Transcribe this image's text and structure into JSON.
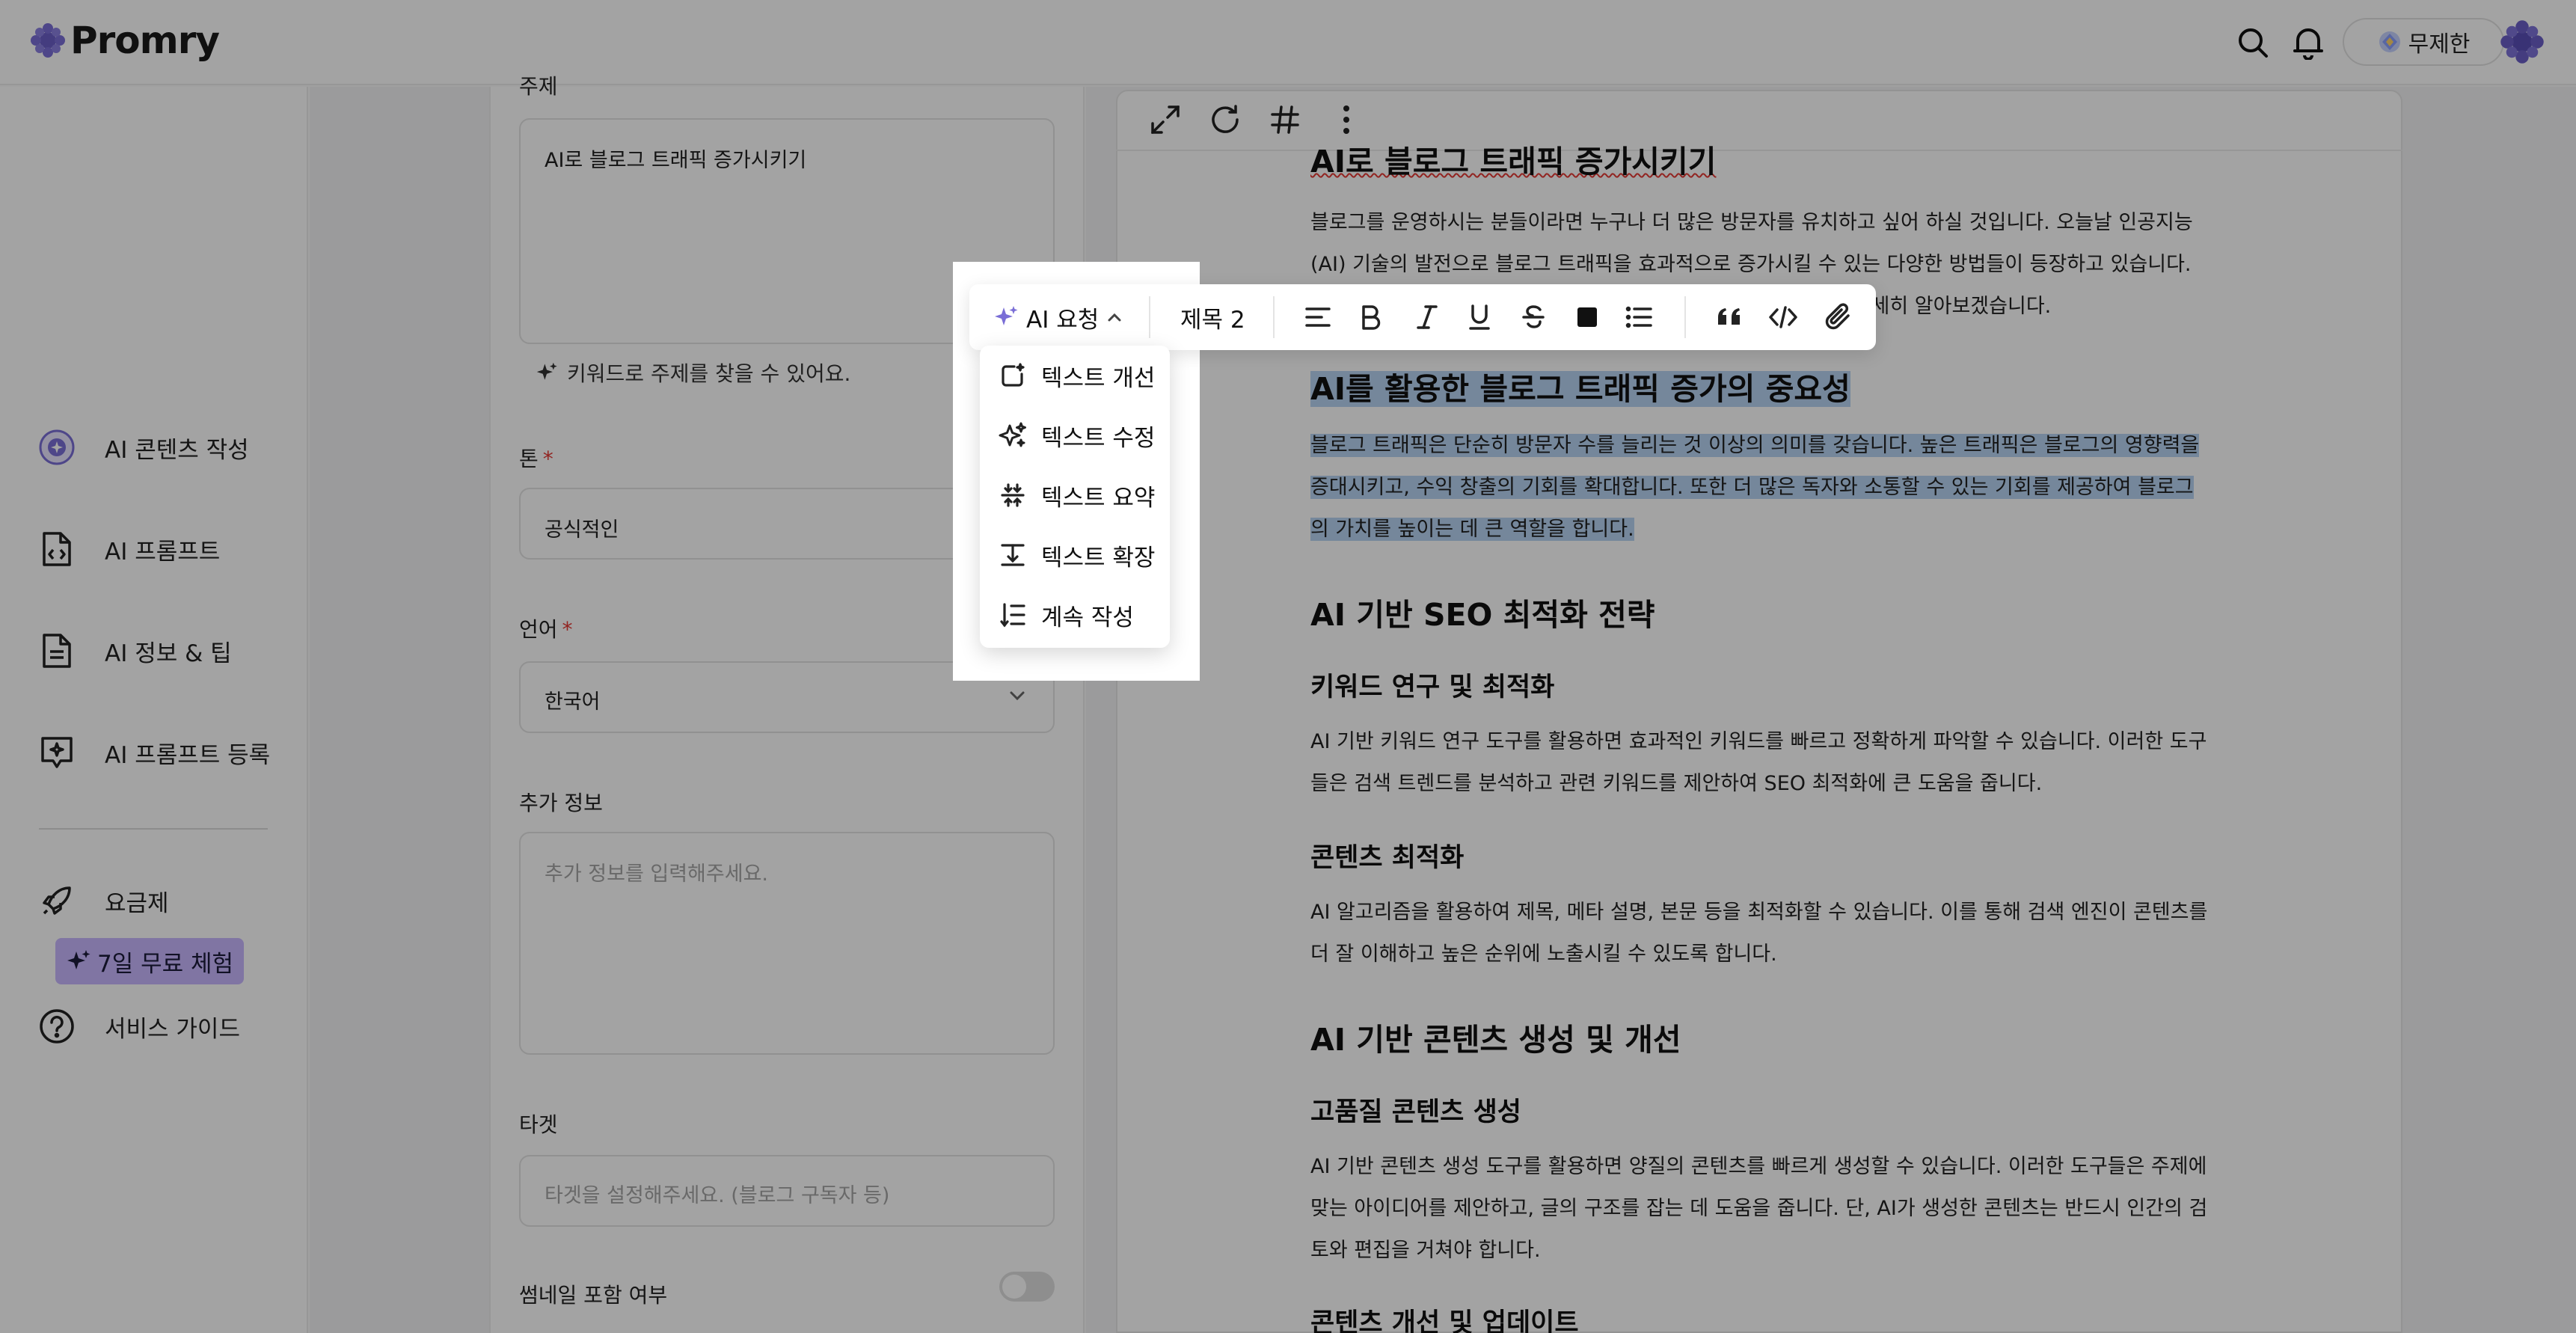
{
  "app": {
    "brand": "Promry",
    "plan_label": "무제한"
  },
  "sidebar": {
    "items": [
      {
        "label": "AI 콘텐츠 작성",
        "icon": "ai-content-icon"
      },
      {
        "label": "AI 프롬프트",
        "icon": "code-file-icon"
      },
      {
        "label": "AI 정보 & 팁",
        "icon": "document-icon"
      },
      {
        "label": "AI 프롬프트 등록",
        "icon": "chat-add-icon"
      },
      {
        "label": "요금제",
        "icon": "rocket-icon"
      },
      {
        "label": "서비스 가이드",
        "icon": "help-circle-icon"
      }
    ],
    "trial_badge": "7일 무료 체험"
  },
  "form": {
    "topic_label": "주제",
    "topic_value": "AI로 블로그 트래픽 증가시키기",
    "topic_hint": "키워드로 주제를 찾을 수 있어요.",
    "tone_label": "톤",
    "tone_value": "공식적인",
    "language_label": "언어",
    "language_value": "한국어",
    "extra_label": "추가 정보",
    "extra_placeholder": "추가 정보를 입력해주세요.",
    "target_label": "타겟",
    "target_placeholder": "타겟을 설정해주세요. (블로그 구독자 등)",
    "thumbnail_label": "썸네일 포함 여부",
    "thumbnail_enabled": false
  },
  "editor": {
    "toolbar_icons": [
      "expand-icon",
      "refresh-icon",
      "hash-icon",
      "more-vertical-icon"
    ],
    "floating": {
      "ai_request_label": "AI 요청",
      "heading_label": "제목 2"
    },
    "ai_menu": [
      {
        "label": "텍스트 개선",
        "icon": "improve-icon"
      },
      {
        "label": "텍스트 수정",
        "icon": "sparkles-icon"
      },
      {
        "label": "텍스트 요약",
        "icon": "summarize-icon"
      },
      {
        "label": "텍스트 확장",
        "icon": "expand-text-icon"
      },
      {
        "label": "계속 작성",
        "icon": "continue-list-icon"
      }
    ],
    "doc": {
      "title": "AI로 블로그 트래픽 증가시키기",
      "intro": "블로그를 운영하시는 분들이라면 누구나 더 많은 방문자를 유치하고 싶어 하실 것입니다. 오늘날 인공지능(AI) 기술의 발전으로 블로그 트래픽을 효과적으로 증가시킬 수 있는 다양한 방법들이 등장하고 있습니다. 이 글에서는 AI를 활용하여 블로그 트래픽을 늘리는 방법에 대해 자세히 알아보겠습니다.",
      "h2_1": "AI를 활용한 블로그 트래픽 증가의 중요성",
      "p1": "블로그 트래픽은 단순히 방문자 수를 늘리는 것 이상의 의미를 갖습니다. 높은 트래픽은 블로그의 영향력을 증대시키고, 수익 창출의 기회를 확대합니다. 또한 더 많은 독자와 소통할 수 있는 기회를 제공하여 블로그의 가치를 높이는 데 큰 역할을 합니다.",
      "h2_2": "AI 기반 SEO 최적화 전략",
      "h3_1": "키워드 연구 및 최적화",
      "p2": "AI 기반 키워드 연구 도구를 활용하면 효과적인 키워드를 빠르고 정확하게 파악할 수 있습니다. 이러한 도구들은 검색 트렌드를 분석하고 관련 키워드를 제안하여 SEO 최적화에 큰 도움을 줍니다.",
      "h3_2": "콘텐츠 최적화",
      "p3": "AI 알고리즘을 활용하여 제목, 메타 설명, 본문 등을 최적화할 수 있습니다. 이를 통해 검색 엔진이 콘텐츠를 더 잘 이해하고 높은 순위에 노출시킬 수 있도록 합니다.",
      "h2_3": "AI 기반 콘텐츠 생성 및 개선",
      "h3_3": "고품질 콘텐츠 생성",
      "p4": "AI 기반 콘텐츠 생성 도구를 활용하면 양질의 콘텐츠를 빠르게 생성할 수 있습니다. 이러한 도구들은 주제에 맞는 아이디어를 제안하고, 글의 구조를 잡는 데 도움을 줍니다. 단, AI가 생성한 콘텐츠는 반드시 인간의 검토와 편집을 거쳐야 합니다.",
      "h3_4": "콘텐츠 개선 및 업데이트"
    }
  }
}
